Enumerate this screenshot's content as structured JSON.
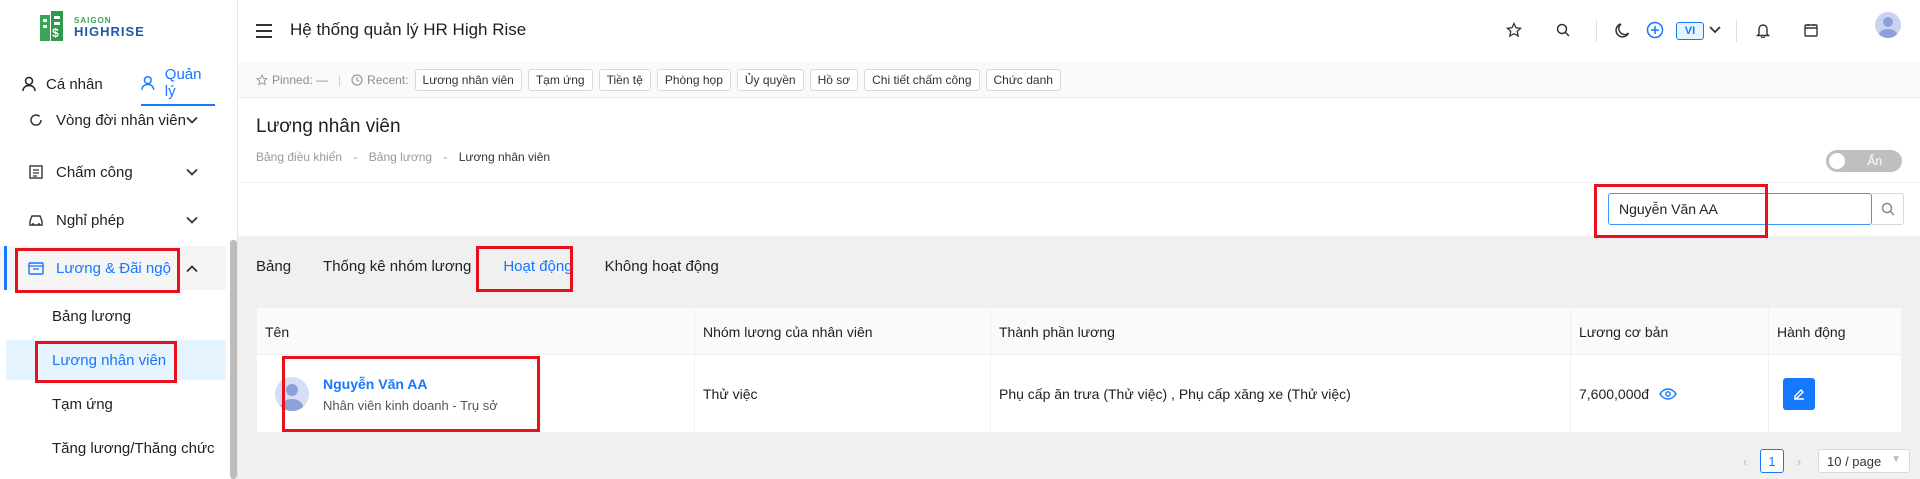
{
  "logo": {
    "small": "SAIGON",
    "big": "HIGHRISE"
  },
  "sidebar": {
    "tabs": [
      {
        "label": "Cá nhân"
      },
      {
        "label": "Quản lý"
      }
    ],
    "menu": [
      {
        "label": "Vòng đời nhân viên"
      },
      {
        "label": "Chấm công"
      },
      {
        "label": "Nghỉ phép"
      },
      {
        "label": "Lương & Đãi ngộ"
      }
    ],
    "submenu": [
      {
        "label": "Bảng lương"
      },
      {
        "label": "Lương nhân viên"
      },
      {
        "label": "Tạm ứng"
      },
      {
        "label": "Tăng lương/Thăng chức"
      }
    ]
  },
  "header": {
    "title": "Hệ thống quản lý HR High Rise",
    "lang": "VI"
  },
  "recent": {
    "pinned_label": "Pinned:",
    "pinned_value": "—",
    "recent_label": "Recent:",
    "chips": [
      "Lương nhân viên",
      "Tạm ứng",
      "Tiền tệ",
      "Phòng họp",
      "Ủy quyền",
      "Hồ sơ",
      "Chi tiết chấm công",
      "Chức danh"
    ]
  },
  "page": {
    "title": "Lương nhân viên",
    "breadcrumb": [
      "Bảng điều khiển",
      "Bảng lương",
      "Lương nhân viên"
    ],
    "breadcrumb_sep": "-",
    "toggle_label": "Ẩn",
    "toggle_on": false
  },
  "search": {
    "value": "Nguyễn Văn AA"
  },
  "tabs": [
    {
      "label": "Bảng"
    },
    {
      "label": "Thống kê nhóm lương"
    },
    {
      "label": "Hoạt động",
      "active": true
    },
    {
      "label": "Không hoạt động"
    }
  ],
  "table": {
    "headers": [
      "Tên",
      "Nhóm lương của nhân viên",
      "Thành phần lương",
      "Lương cơ bản",
      "Hành động"
    ],
    "rows": [
      {
        "name": "Nguyễn Văn AA",
        "subtitle": "Nhân viên kinh doanh - Trụ sở",
        "group": "Thử việc",
        "components": "Phụ cấp ăn trưa (Thử việc) , Phụ cấp xăng xe (Thử việc)",
        "base_salary": "7,600,000đ"
      }
    ]
  },
  "pagination": {
    "current": "1",
    "page_size": "10 / page"
  },
  "colors": {
    "accent": "#1677ff",
    "annotation": "#e8101a"
  }
}
